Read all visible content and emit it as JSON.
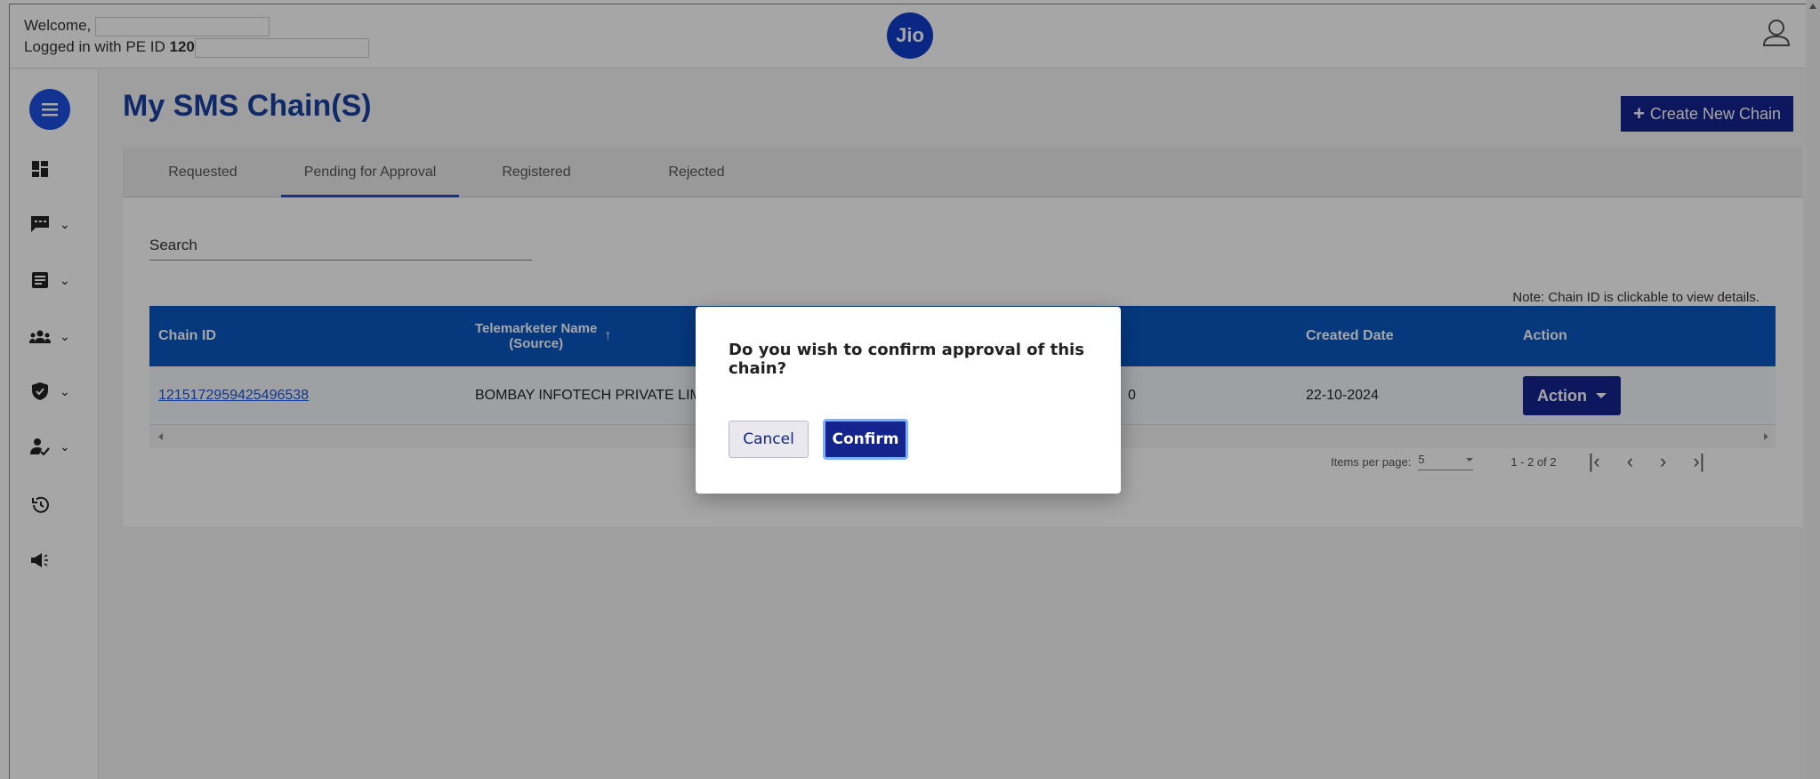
{
  "header": {
    "welcome_label": "Welcome,",
    "logged_in_label": "Logged in with PE ID",
    "pe_id_prefix": "120",
    "logo_text": "Jio"
  },
  "sidebar": {
    "items": [
      {
        "icon": "dashboard-icon"
      },
      {
        "icon": "message-icon",
        "has_chevron": true
      },
      {
        "icon": "document-icon",
        "has_chevron": true
      },
      {
        "icon": "group-icon",
        "has_chevron": true
      },
      {
        "icon": "shield-icon",
        "has_chevron": true
      },
      {
        "icon": "user-check-icon",
        "has_chevron": true
      },
      {
        "icon": "history-icon"
      },
      {
        "icon": "megaphone-icon"
      }
    ]
  },
  "main": {
    "title": "My SMS Chain(S)",
    "create_button": "Create New Chain",
    "tabs": [
      {
        "label": "Requested"
      },
      {
        "label": "Pending for Approval",
        "active": true
      },
      {
        "label": "Registered"
      },
      {
        "label": "Rejected"
      }
    ],
    "search_placeholder": "Search",
    "note": "Note: Chain ID is clickable to view details.",
    "table": {
      "headers": [
        "Chain ID",
        "Telemarketer Name\n(Source)",
        "Created Date",
        "Action"
      ],
      "rows": [
        {
          "chain_id": "1215172959425496538",
          "telemarketer": "BOMBAY INFOTECH PRIVATE LIMI",
          "hidden_col_tail": "0",
          "created_date": "22-10-2024",
          "action_label": "Action"
        }
      ]
    },
    "paginator": {
      "items_per_page_label": "Items per page:",
      "items_per_page_value": "5",
      "range_label": "1 - 2 of 2"
    }
  },
  "dialog": {
    "message": "Do you wish to confirm approval of this chain?",
    "cancel_label": "Cancel",
    "confirm_label": "Confirm"
  },
  "colors": {
    "primary": "#13248f",
    "table_header": "#0a57c2",
    "title": "#1a3fa0",
    "logo": "#0f3cc9"
  }
}
